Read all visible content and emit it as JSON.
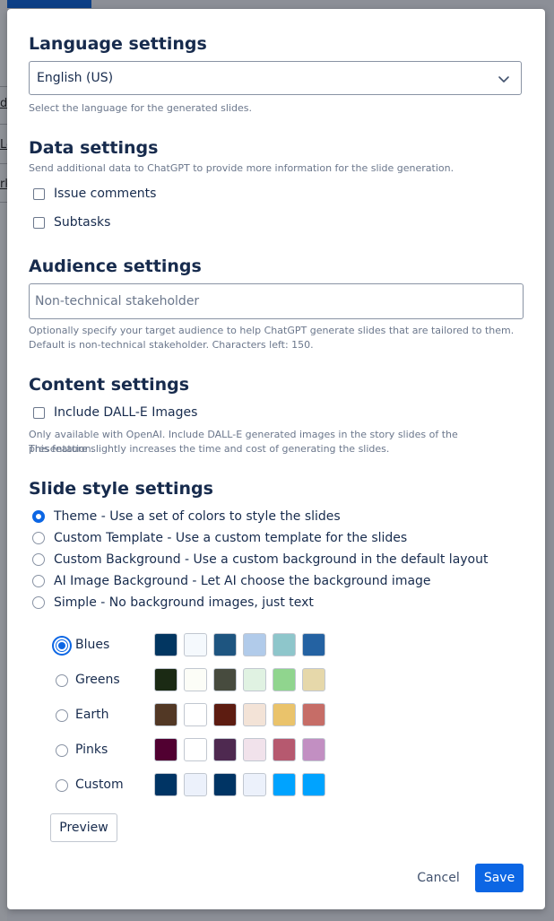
{
  "language": {
    "heading": "Language settings",
    "selected": "English (US)",
    "help": "Select the language for the generated slides."
  },
  "data_settings": {
    "heading": "Data settings",
    "help": "Send additional data to ChatGPT to provide more information for the slide generation.",
    "options": [
      {
        "label": "Issue comments",
        "checked": false
      },
      {
        "label": "Subtasks",
        "checked": false
      }
    ]
  },
  "audience": {
    "heading": "Audience settings",
    "placeholder": "Non-technical stakeholder",
    "value": "",
    "help_line1": "Optionally specify your target audience to help ChatGPT generate slides that are tailored to them.",
    "help_line2": "Default is non-technical stakeholder. Characters left: 150."
  },
  "content": {
    "heading": "Content settings",
    "option_label": "Include DALL-E Images",
    "checked": false,
    "help_line1": "Only available with OpenAI. Include DALL-E generated images in the story slides of the presentation.",
    "help_line2": "This feature slightly increases the time and cost of generating the slides."
  },
  "slide_style": {
    "heading": "Slide style settings",
    "selected_index": 0,
    "options": [
      {
        "label": "Theme - Use a set of colors to style the slides"
      },
      {
        "label": "Custom Template - Use a custom template for the slides"
      },
      {
        "label": "Custom Background - Use a custom background in the default layout"
      },
      {
        "label": "AI Image Background - Let AI choose the background image"
      },
      {
        "label": "Simple - No background images, just text"
      }
    ]
  },
  "themes": {
    "selected_index": 0,
    "items": [
      {
        "name": "Blues",
        "colors": [
          "#023661",
          "#f5f9fd",
          "#1e5580",
          "#b1cbea",
          "#8ec6cb",
          "#2462a2"
        ]
      },
      {
        "name": "Greens",
        "colors": [
          "#1b2a14",
          "#fcfdf7",
          "#474b3e",
          "#e0f2e2",
          "#90d58e",
          "#e6d8aa"
        ]
      },
      {
        "name": "Earth",
        "colors": [
          "#523825",
          "#ffffff",
          "#5d1c11",
          "#f3e3d7",
          "#eac36b",
          "#c66d67"
        ]
      },
      {
        "name": "Pinks",
        "colors": [
          "#510031",
          "#ffffff",
          "#4e2950",
          "#f1e2eb",
          "#b6596f",
          "#c28fc2"
        ]
      },
      {
        "name": "Custom",
        "colors": [
          "#003464",
          "#ecf1fb",
          "#003464",
          "#ecf1fb",
          "#00a3ff",
          "#00a3ff"
        ]
      }
    ]
  },
  "buttons": {
    "preview": "Preview",
    "cancel": "Cancel",
    "save": "Save"
  },
  "background_fragments": [
    "d",
    "Le",
    "rk"
  ],
  "colors": {
    "primary": "#0c66e4",
    "text": "#172b4d",
    "subtle": "#6b778c"
  }
}
